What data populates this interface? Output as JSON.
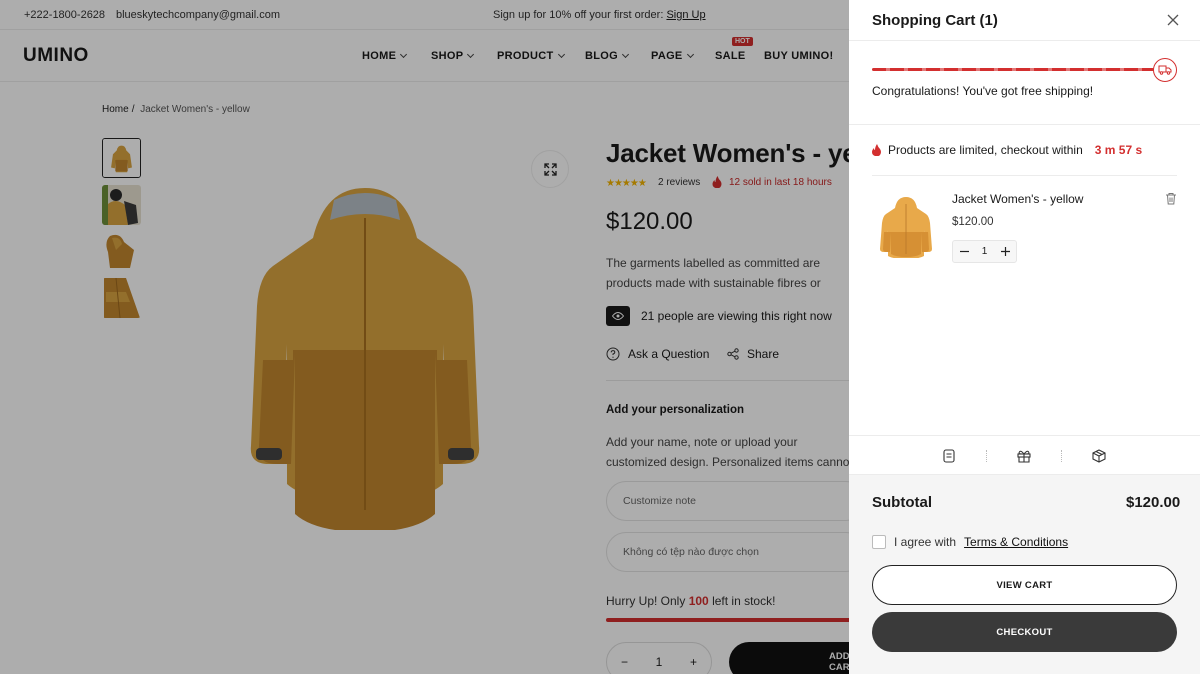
{
  "topbar": {
    "phone": "+222-1800-2628",
    "email": "blueskytechcompany@gmail.com",
    "promo_text": "Sign up for 10% off your first order:",
    "promo_link": "Sign Up"
  },
  "header": {
    "logo": "UMINO",
    "nav": [
      "HOME",
      "SHOP",
      "PRODUCT",
      "BLOG",
      "PAGE",
      "SALE",
      "BUY UMINO!"
    ],
    "hot_badge": "HOT"
  },
  "breadcrumb": {
    "home": "Home",
    "separator": "/",
    "current": "Jacket Women's - yellow"
  },
  "product": {
    "title": "Jacket Women's - yellow",
    "stars": "★★★★★",
    "reviews": "2 reviews",
    "sold": "12 sold in last 18 hours",
    "price": "$120.00",
    "description": "The garments labelled as committed are products made with sustainable fibres or processes, reducing their environmental impact.",
    "viewing": "21 people are viewing this right now",
    "ask": "Ask a Question",
    "share": "Share",
    "personalization_title": "Add your personalization",
    "personalization_text": "Add your name, note or upload your customized design. Personalized items cannot be returned or exchanged.",
    "note_placeholder": "Customize note",
    "file_text": "Không có tệp nào được chọn",
    "stock_prefix": "Hurry Up! Only",
    "stock_count": "100",
    "stock_suffix": "left in stock!",
    "quantity": "1",
    "add_label": "ADD TO CART"
  },
  "cart": {
    "title": "Shopping Cart (1)",
    "shipping_progress": 1.0,
    "shipping_message": "Congratulations! You've got free shipping!",
    "limited_text": "Products are limited, checkout within",
    "timer": "3 m 57 s",
    "item": {
      "name": "Jacket Women's - yellow",
      "price": "$120.00",
      "quantity": "1"
    },
    "tools": [
      "note-icon",
      "gift-icon",
      "shipping-box-icon"
    ],
    "subtotal_label": "Subtotal",
    "subtotal_value": "$120.00",
    "agree_text": "I agree with",
    "terms_text": "Terms & Conditions",
    "view_cart": "VIEW CART",
    "checkout": "CHECKOUT"
  },
  "colors": {
    "accent_red": "#d32f2f",
    "stars": "#f4b400",
    "jacket_upper": "#d9a441",
    "jacket_lower": "#c2862e",
    "checkout_bg": "#3a3a3a"
  }
}
